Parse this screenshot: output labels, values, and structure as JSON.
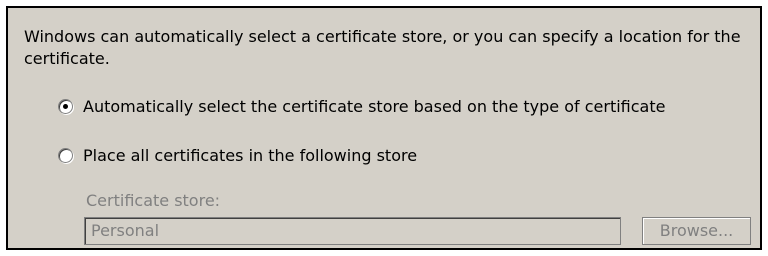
{
  "intro_text": "Windows can automatically select a certificate store, or you can specify a location for the certificate.",
  "options": [
    {
      "label": "Automatically select the certificate store based on the type of certificate",
      "selected": true
    },
    {
      "label": "Place all certificates in the following store",
      "selected": false
    }
  ],
  "store": {
    "label": "Certificate store:",
    "value": "Personal",
    "enabled": false
  },
  "browse_button": {
    "label": "Browse...",
    "enabled": false
  },
  "colors": {
    "dialog_background": "#d4d0c8",
    "disabled_text": "#808080"
  }
}
